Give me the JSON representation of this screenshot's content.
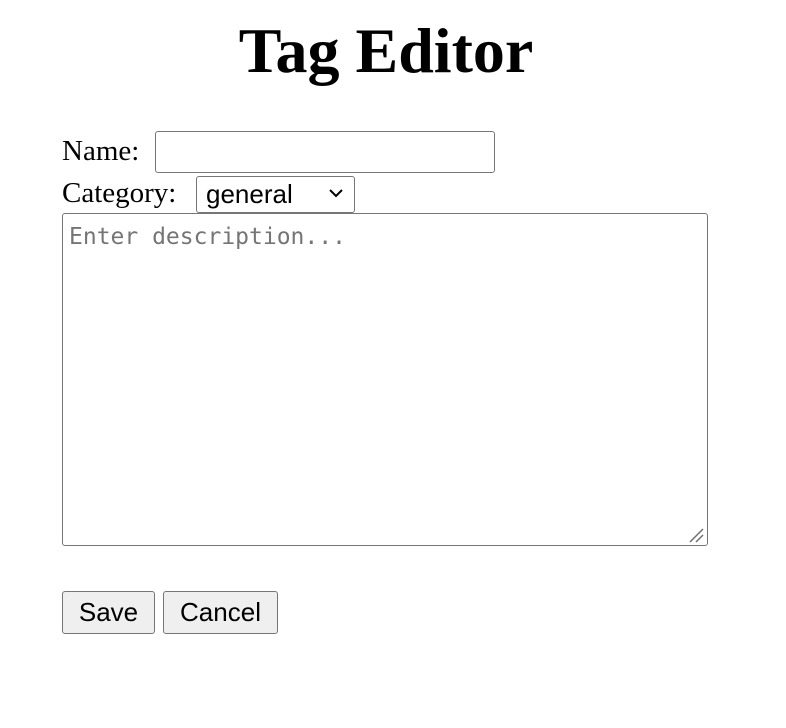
{
  "page": {
    "title": "Tag Editor"
  },
  "form": {
    "name": {
      "label": "Name:",
      "value": "",
      "placeholder": ""
    },
    "category": {
      "label": "Category:",
      "selected": "general"
    },
    "description": {
      "value": "",
      "placeholder": "Enter description..."
    }
  },
  "actions": {
    "save_label": "Save",
    "cancel_label": "Cancel"
  },
  "icons": {
    "select": "chevron-down-icon",
    "textarea": "resize-handle-icon"
  }
}
